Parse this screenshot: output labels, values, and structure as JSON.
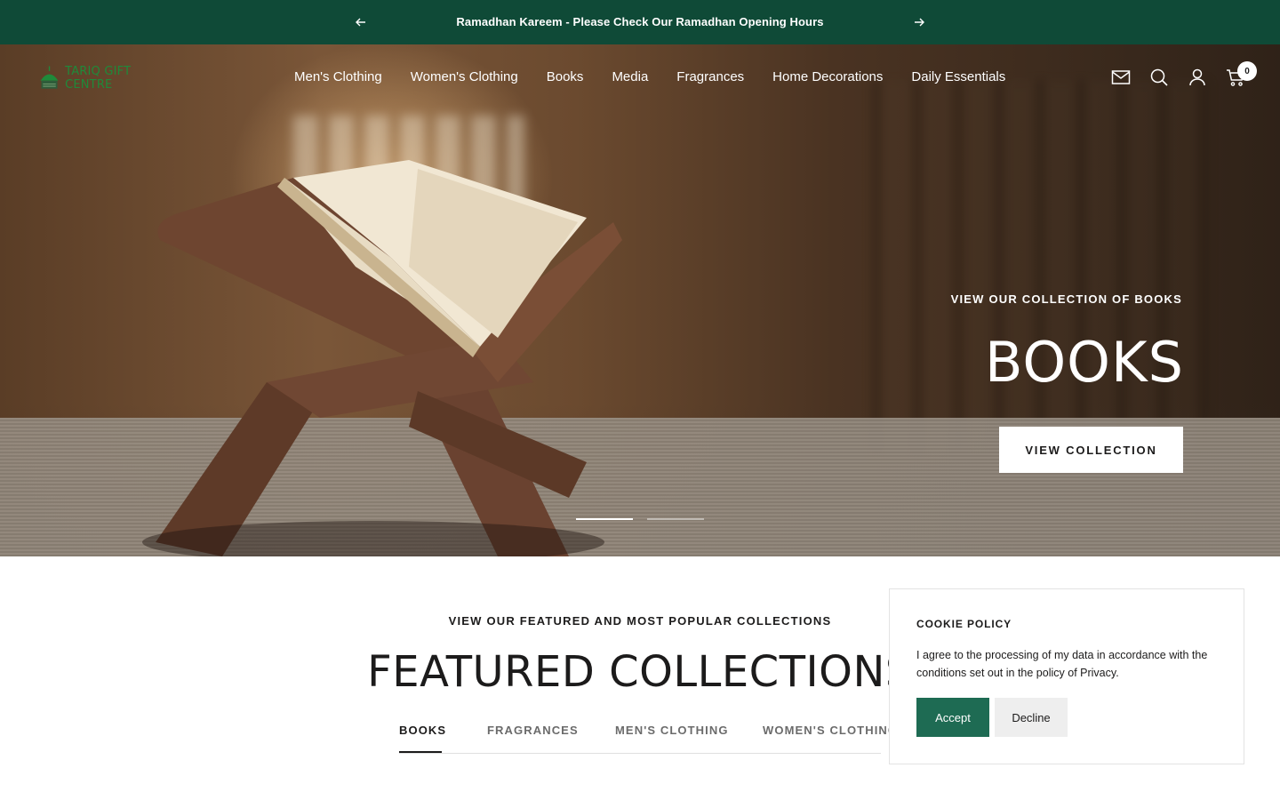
{
  "announcement": {
    "message": "Ramadhan Kareem - Please Check Our Ramadhan Opening Hours",
    "prev_icon": "arrow-left-icon",
    "next_icon": "arrow-right-icon"
  },
  "header": {
    "logo_text": "TARIQ GIFT CENTRE",
    "nav": [
      {
        "label": "Men's Clothing"
      },
      {
        "label": "Women's Clothing"
      },
      {
        "label": "Books"
      },
      {
        "label": "Media"
      },
      {
        "label": "Fragrances"
      },
      {
        "label": "Home Decorations"
      },
      {
        "label": "Daily Essentials"
      }
    ],
    "icons": [
      "mail-icon",
      "search-icon",
      "account-icon",
      "cart-icon"
    ],
    "cart_count": "0"
  },
  "hero": {
    "subheading": "VIEW OUR COLLECTION OF BOOKS",
    "title": "BOOKS",
    "button_label": "VIEW COLLECTION",
    "slides": 2,
    "active_slide": 1
  },
  "featured": {
    "subheading": "VIEW OUR FEATURED AND MOST POPULAR COLLECTIONS",
    "title": "FEATURED COLLECTIONS",
    "tabs": [
      {
        "label": "BOOKS",
        "active": true
      },
      {
        "label": "FRAGRANCES",
        "active": false
      },
      {
        "label": "MEN'S CLOTHING",
        "active": false
      },
      {
        "label": "WOMEN'S CLOTHING",
        "active": false
      }
    ]
  },
  "cookie": {
    "title": "COOKIE POLICY",
    "text": "I agree to the processing of my data in accordance with the conditions set out in the policy of Privacy.",
    "accept_label": "Accept",
    "decline_label": "Decline"
  },
  "colors": {
    "announcement_bg": "#0f4a37",
    "accept_bg": "#1e6b53",
    "decline_bg": "#eeeeee",
    "text": "#1c1b1b"
  }
}
